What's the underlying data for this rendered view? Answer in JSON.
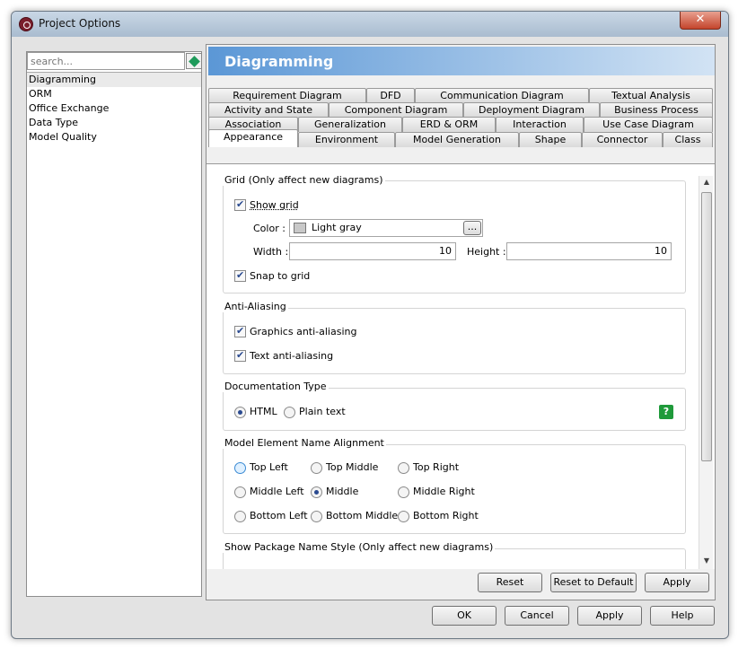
{
  "window": {
    "title": "Project Options",
    "close": "✕"
  },
  "search": {
    "placeholder": "search..."
  },
  "sidebar": {
    "items": [
      "Diagramming",
      "ORM",
      "Office Exchange",
      "Data Type",
      "Model Quality"
    ]
  },
  "header": {
    "title": "Diagramming"
  },
  "tabs": {
    "row1": [
      "Requirement Diagram",
      "DFD",
      "Communication Diagram",
      "Textual Analysis"
    ],
    "row2": [
      "Activity and State",
      "Component Diagram",
      "Deployment Diagram",
      "Business Process"
    ],
    "row3": [
      "Association",
      "Generalization",
      "ERD & ORM",
      "Interaction",
      "Use Case Diagram"
    ],
    "row4": [
      "Appearance",
      "Environment",
      "Model Generation",
      "Shape",
      "Connector",
      "Class"
    ]
  },
  "grid": {
    "title": "Grid (Only affect new diagrams)",
    "show_grid": "Show grid",
    "color_label": "Color :",
    "color_value": "Light gray",
    "color_btn": "...",
    "width_label": "Width :",
    "width_value": "10",
    "height_label": "Height :",
    "height_value": "10",
    "snap": "Snap to grid"
  },
  "aa": {
    "title": "Anti-Aliasing",
    "graphics": "Graphics anti-aliasing",
    "text": "Text anti-aliasing"
  },
  "doc": {
    "title": "Documentation Type",
    "html": "HTML",
    "plain": "Plain text",
    "help": "?"
  },
  "align": {
    "title": "Model Element Name Alignment",
    "options": [
      "Top Left",
      "Top Middle",
      "Top Right",
      "Middle Left",
      "Middle",
      "Middle Right",
      "Bottom Left",
      "Bottom Middle",
      "Bottom Right"
    ]
  },
  "pkg": {
    "title": "Show Package Name Style (Only affect new diagrams)"
  },
  "panel_buttons": {
    "reset": "Reset",
    "reset_default": "Reset to Default",
    "apply": "Apply"
  },
  "dialog_buttons": {
    "ok": "OK",
    "cancel": "Cancel",
    "apply": "Apply",
    "help": "Help"
  }
}
